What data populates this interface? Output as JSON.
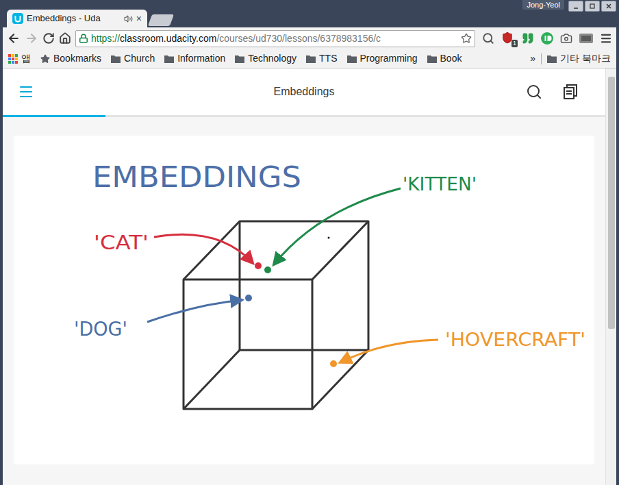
{
  "window": {
    "user": "Jong-Yeol"
  },
  "tabs": [
    {
      "title": "Embeddings - Uda",
      "close": "×",
      "selected": true,
      "audio": true
    }
  ],
  "address_bar": {
    "scheme": "https://",
    "host": "classroom.udacity.com",
    "path": "/courses/ud730/lessons/6378983156/c",
    "secure": true,
    "bookmarked": false
  },
  "extension_badge": "1",
  "bookmarks_bar": {
    "apps": "앱",
    "items": [
      {
        "label": "Bookmarks",
        "kind": "star"
      },
      {
        "label": "Church",
        "kind": "folder"
      },
      {
        "label": "Information",
        "kind": "folder"
      },
      {
        "label": "Technology",
        "kind": "folder"
      },
      {
        "label": "TTS",
        "kind": "folder"
      },
      {
        "label": "Programming",
        "kind": "folder"
      },
      {
        "label": "Book",
        "kind": "folder"
      }
    ],
    "overflow": "»",
    "other": "기타 북마크"
  },
  "page": {
    "title": "Embeddings",
    "progress": {
      "level": 0.17
    }
  },
  "diagram": {
    "title": "EMBEDDINGS",
    "points": [
      {
        "label": "'CAT'",
        "color": "#d62e3e"
      },
      {
        "label": "'KITTEN'",
        "color": "#1e8a4a"
      },
      {
        "label": "'DOG'",
        "color": "#4a6fa5"
      },
      {
        "label": "'HOVERCRAFT'",
        "color": "#f0962a"
      }
    ]
  }
}
